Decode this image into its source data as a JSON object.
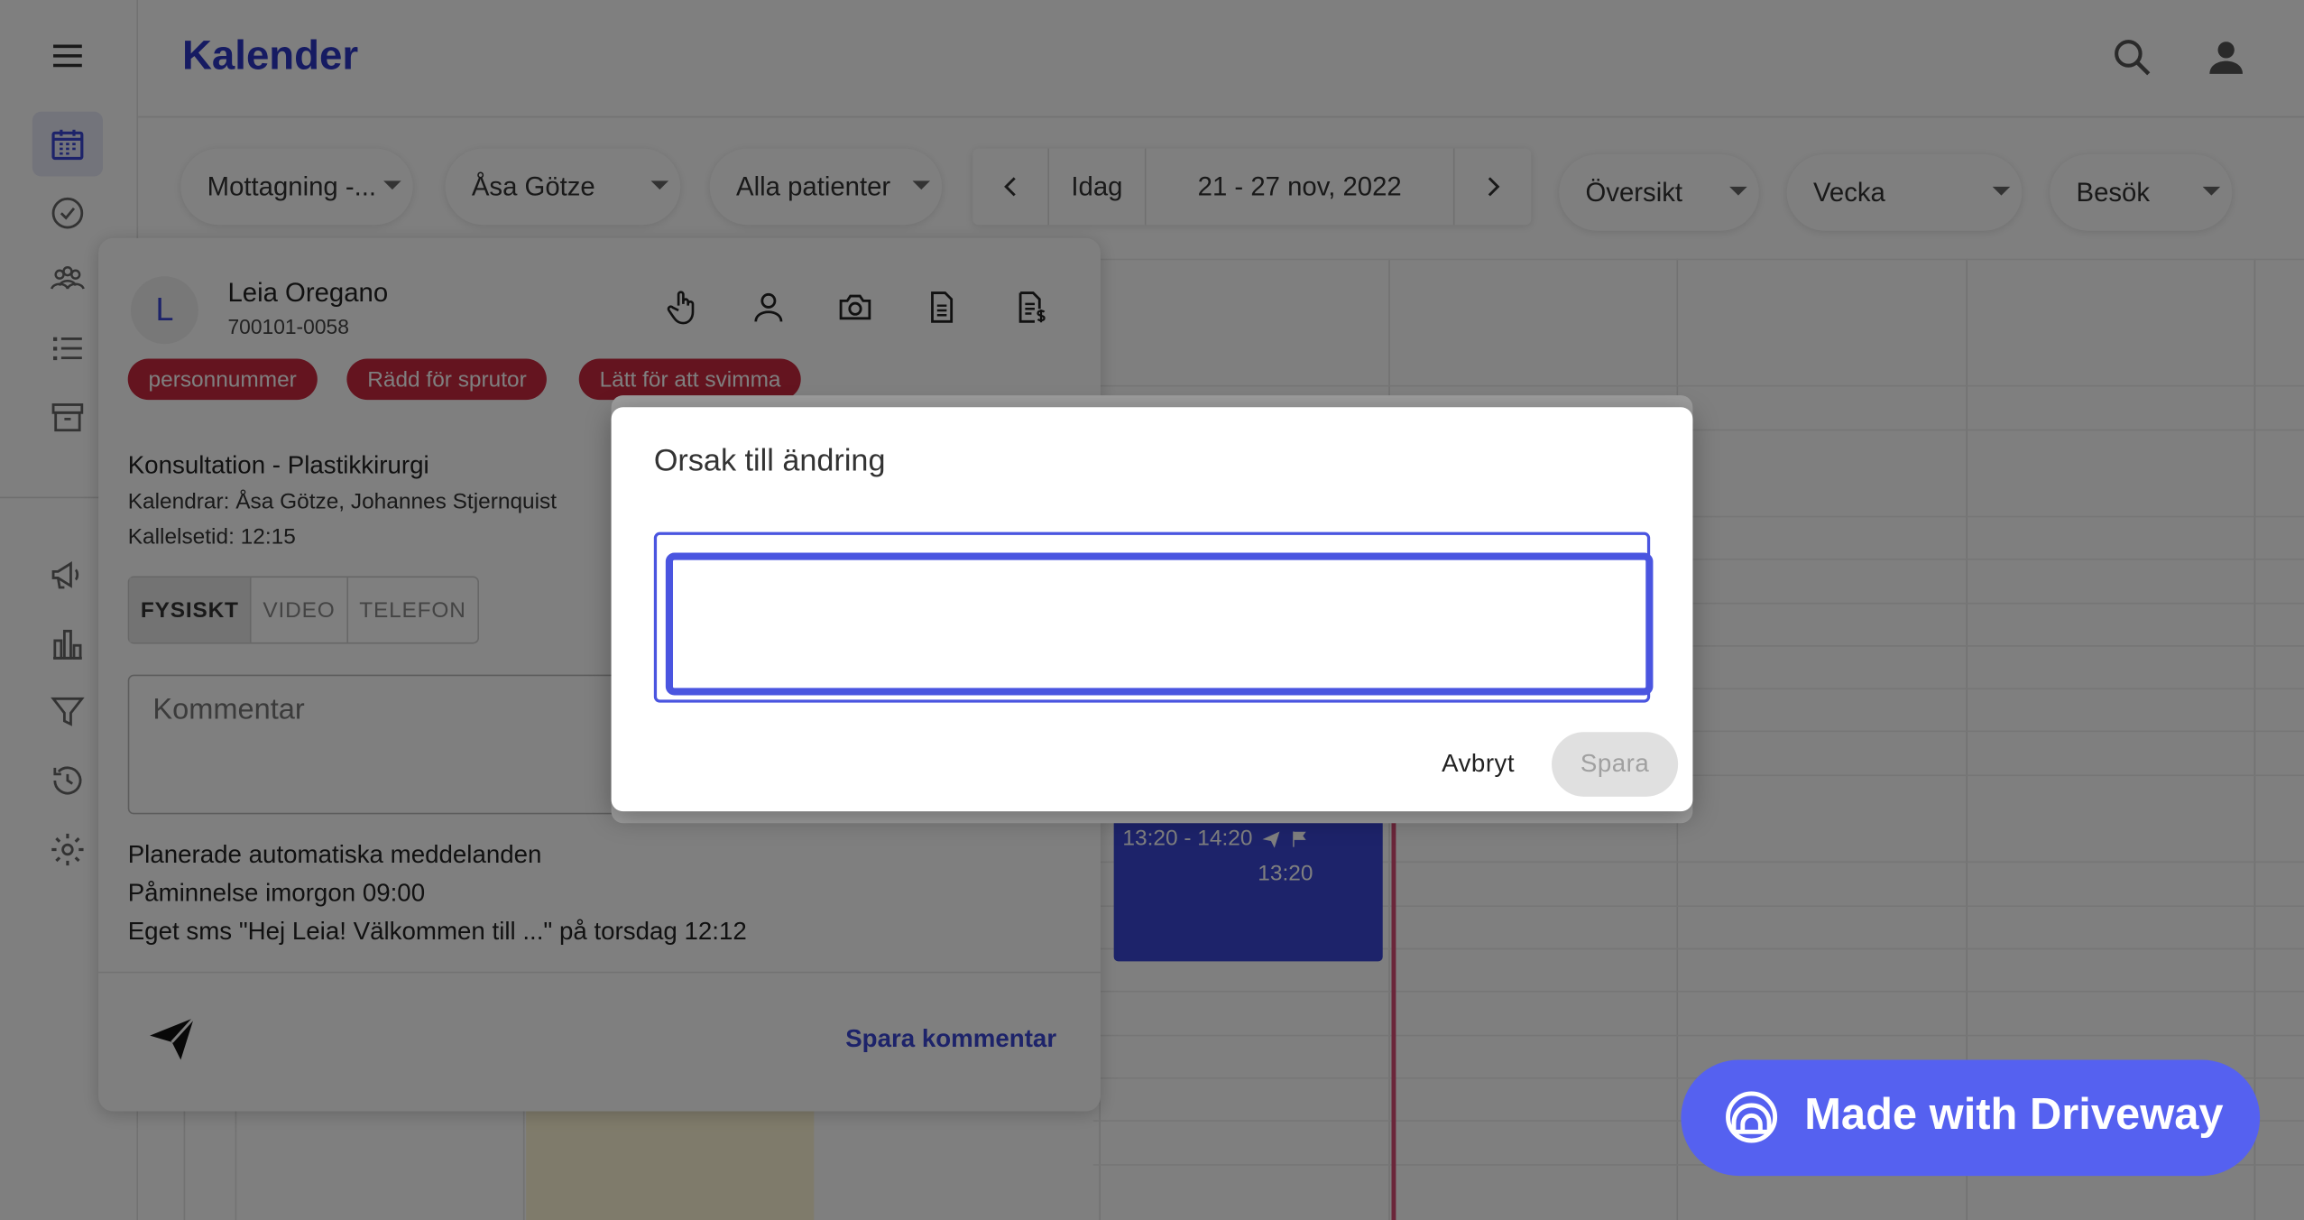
{
  "header": {
    "title": "Kalender"
  },
  "filters": {
    "location": "Mottagning -...",
    "practitioner": "Åsa Götze",
    "patients": "Alla patienter",
    "overview": "Översikt",
    "range": "Vecka",
    "type": "Besök"
  },
  "datenav": {
    "today": "Idag",
    "range": "21 - 27 nov, 2022"
  },
  "event": {
    "time": "13:20 - 14:20",
    "sub": "13:20"
  },
  "patient": {
    "initial": "L",
    "name": "Leia Oregano",
    "id": "700101-0058",
    "tags": [
      "personnummer",
      "Rädd för sprutor",
      "Lätt för att svimma"
    ],
    "appointment_title": "Konsultation - Plastikkirurgi",
    "calendars": "Kalendrar: Åsa Götze, Johannes Stjernquist",
    "call_time": "Kallelsetid: 12:15",
    "modes": [
      "FYSISKT",
      "VIDEO",
      "TELEFON"
    ],
    "selected_mode": "FYSISKT",
    "comment_placeholder": "Kommentar",
    "auto_title": "Planerade automatiska meddelanden",
    "auto_items": [
      "Påminnelse imorgon 09:00",
      "Eget sms \"Hej Leia! Välkommen till ...\" på torsdag 12:12"
    ],
    "save_comment": "Spara kommentar"
  },
  "dialog": {
    "title": "Orsak till ändring",
    "reason_value": "",
    "cancel": "Avbryt",
    "save": "Spara"
  },
  "badge": {
    "label": "Made with Driveway"
  },
  "colors": {
    "brand": "#2c36c4",
    "accent": "#4a55e0",
    "tag": "#c8283e",
    "now_line": "#d64c74",
    "badge": "#5561f0"
  },
  "icons": {
    "rail": [
      "menu-icon",
      "calendar-icon",
      "check-circle-icon",
      "group-icon",
      "list-icon",
      "archive-icon",
      "megaphone-icon",
      "bar-chart-icon",
      "filter-icon",
      "history-icon",
      "gear-icon"
    ],
    "header": [
      "search-icon",
      "user-icon"
    ],
    "panel": [
      "hand-pointer-icon",
      "person-icon",
      "camera-icon",
      "document-icon",
      "invoice-icon",
      "send-icon"
    ]
  }
}
